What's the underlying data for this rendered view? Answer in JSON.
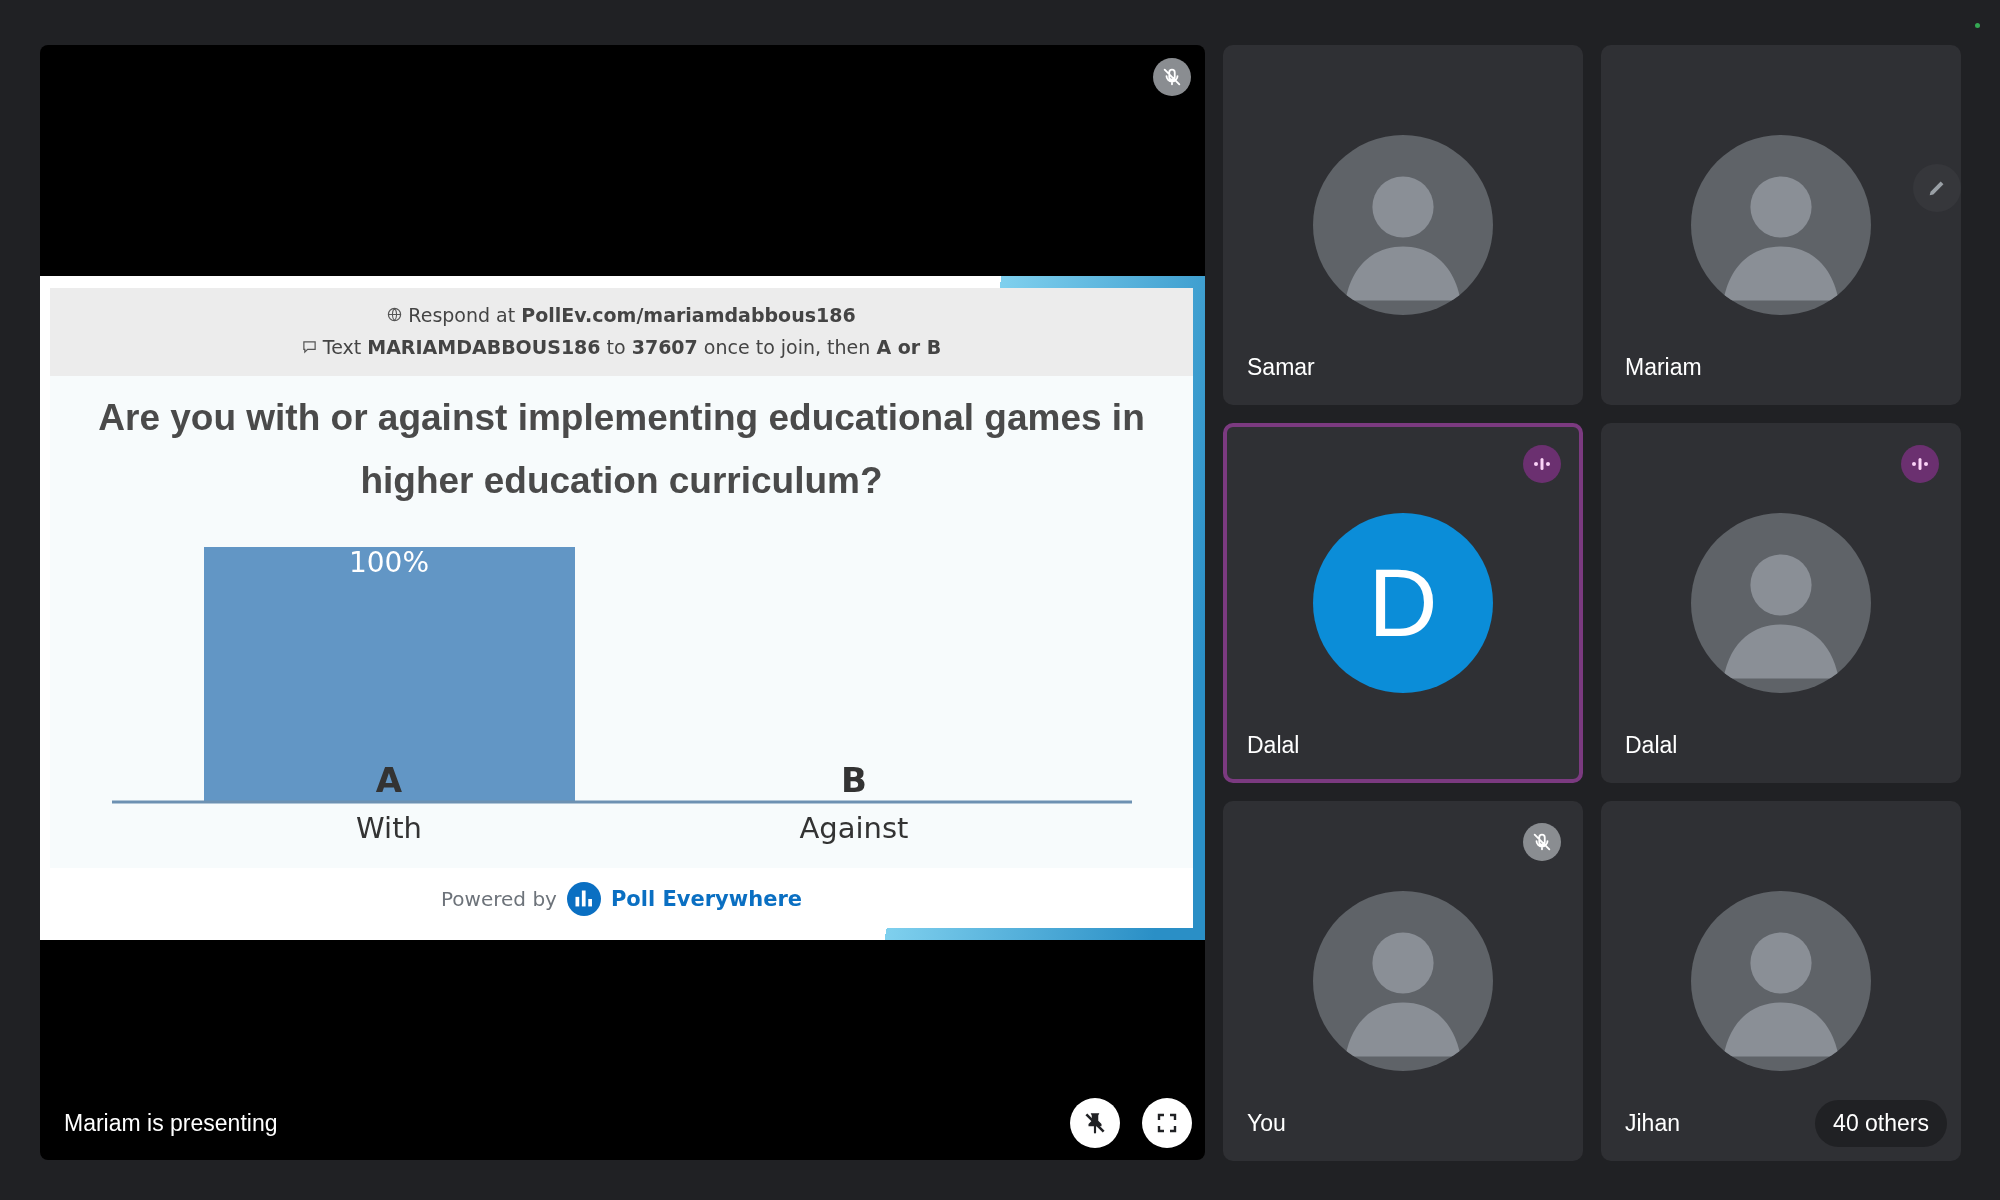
{
  "presentation": {
    "mic_muted": true,
    "slide": {
      "respond_line": "Respond at **PollEv.com/mariamdabbous186**",
      "text_line": "Text **MARIAMDABBOUS186** to **37607** once to join, then **A or B**",
      "question": "Are you with or against implementing educational games in higher education curriculum?",
      "chart_data": {
        "type": "bar",
        "categories": [
          "With",
          "Against"
        ],
        "values": [
          100,
          0
        ],
        "ylim": [
          0,
          100
        ],
        "value_labels": [
          "100%",
          null
        ]
      },
      "option_letters": [
        "A",
        "B"
      ],
      "footer_prefix": "Powered by",
      "brand": "Poll Everywhere"
    },
    "caption": "Mariam is presenting",
    "controls": [
      {
        "kind": "unpin"
      },
      {
        "kind": "fullscreen"
      }
    ]
  },
  "participants": [
    {
      "name": "Samar",
      "kind": "photo",
      "muted": false,
      "speaking": false,
      "active": false,
      "edit_visible": false
    },
    {
      "name": "Mariam",
      "kind": "photo",
      "muted": false,
      "speaking": false,
      "active": false,
      "edit_visible": true
    },
    {
      "name": "Dalal",
      "kind": "initial",
      "initial": "D",
      "muted": false,
      "speaking": true,
      "active": true,
      "edit_visible": false
    },
    {
      "name": "Dalal",
      "kind": "photo",
      "muted": false,
      "speaking": true,
      "active": false,
      "edit_visible": false
    },
    {
      "name": "You",
      "kind": "photo",
      "muted": true,
      "speaking": false,
      "active": false,
      "edit_visible": false
    },
    {
      "name": "Jihan",
      "kind": "photo",
      "muted": false,
      "speaking": false,
      "active": false,
      "edit_visible": false,
      "badge": "40 others"
    }
  ]
}
